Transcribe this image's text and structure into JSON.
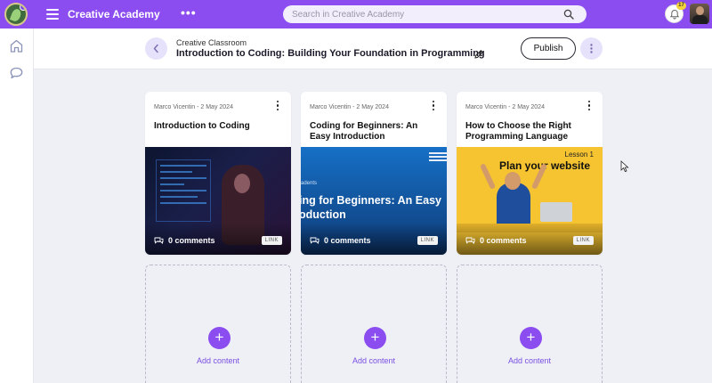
{
  "topbar": {
    "app_title": "Creative Academy",
    "more_symbol": "•••",
    "search_placeholder": "Search in Creative Academy",
    "notification_count": "17",
    "accent_color": "#8b4cf0"
  },
  "sidebar": {
    "items": [
      {
        "icon": "home-icon"
      },
      {
        "icon": "chat-icon"
      }
    ]
  },
  "header": {
    "breadcrumb": "Creative Classroom",
    "title": "Introduction to Coding: Building Your Foundation in Programming",
    "publish_label": "Publish"
  },
  "cards": [
    {
      "meta": "Marco Vicentin - 2 May 2024",
      "title": "Introduction to Coding",
      "comments": "0 comments",
      "tag": "LINK"
    },
    {
      "meta": "Marco Vicentin - 2 May 2024",
      "title": "Coding for Beginners: An Easy Introduction",
      "comments": "0 comments",
      "tag": "LINK",
      "thumb_small": "adents",
      "thumb_line1": "ing for Beginners: An Easy",
      "thumb_line2": "oduction"
    },
    {
      "meta": "Marco Vicentin - 2 May 2024",
      "title": "How to Choose the Right Programming Language",
      "comments": "0 comments",
      "tag": "LINK",
      "thumb_lesson": "Lesson 1",
      "thumb_headline": "Plan your website"
    }
  ],
  "add_cards": [
    {
      "label": "Add content",
      "symbol": "+"
    },
    {
      "label": "Add content",
      "symbol": "+"
    },
    {
      "label": "Add content",
      "symbol": "+"
    }
  ]
}
